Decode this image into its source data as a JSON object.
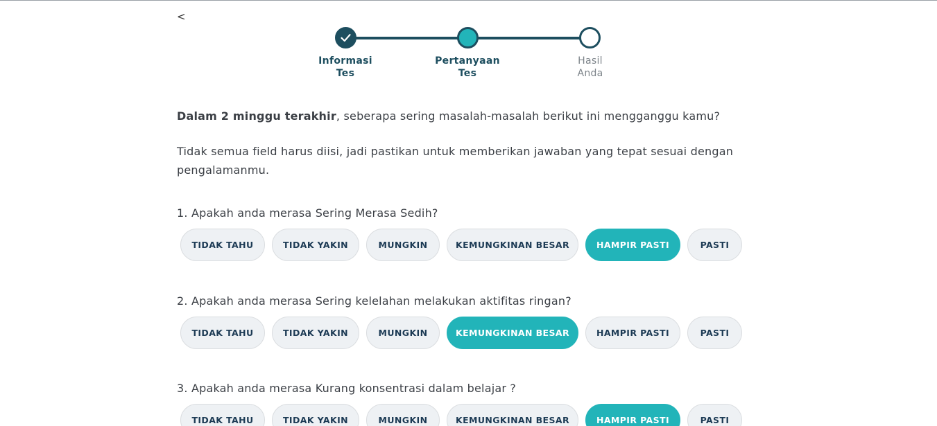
{
  "nav": {
    "back_label": "<"
  },
  "stepper": {
    "steps": [
      {
        "line1": "Informasi",
        "line2": "Tes",
        "state": "done"
      },
      {
        "line1": "Pertanyaan",
        "line2": "Tes",
        "state": "current"
      },
      {
        "line1": "Hasil",
        "line2": "Anda",
        "state": "todo"
      }
    ]
  },
  "intro": {
    "emphasis": "Dalam 2 minggu terakhir",
    "rest": ", seberapa sering masalah-masalah berikut ini mengganggu kamu?",
    "note": "Tidak semua field harus diisi, jadi pastikan untuk memberikan jawaban yang tepat sesuai dengan pengalamanmu."
  },
  "options": [
    "TIDAK TAHU",
    "TIDAK YAKIN",
    "MUNGKIN",
    "KEMUNGKINAN BESAR",
    "HAMPIR PASTI",
    "PASTI"
  ],
  "questions": [
    {
      "text": "1. Apakah anda merasa Sering Merasa Sedih?",
      "selected": "HAMPIR PASTI"
    },
    {
      "text": "2. Apakah anda merasa Sering kelelahan melakukan aktifitas ringan?",
      "selected": "KEMUNGKINAN BESAR"
    },
    {
      "text": "3. Apakah anda merasa Kurang konsentrasi dalam belajar ?",
      "selected": "HAMPIR PASTI"
    }
  ],
  "colors": {
    "primary": "#1d4e5f",
    "accent": "#22b4b9",
    "option_bg": "#eef1f4"
  }
}
